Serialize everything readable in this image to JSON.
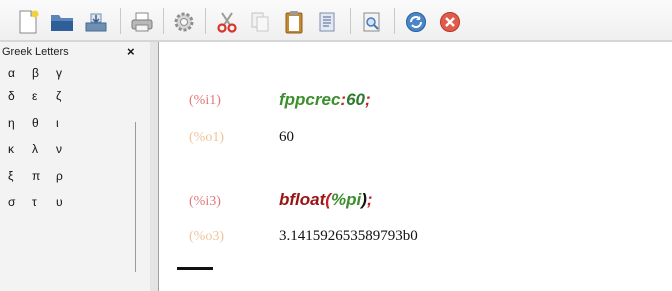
{
  "toolbar": {
    "icons": [
      "new-document-icon",
      "open-folder-icon",
      "save-icon",
      "print-icon",
      "settings-icon",
      "cut-icon",
      "copy-icon",
      "paste-icon",
      "select-all-icon",
      "find-icon",
      "refresh-icon",
      "interrupt-icon"
    ]
  },
  "greek_panel": {
    "title": "Greek Letters",
    "close": "×",
    "rows": [
      [
        "α",
        "β",
        "γ"
      ],
      [
        "δ",
        "ε",
        "ζ"
      ],
      [
        "η",
        "θ",
        "ι"
      ],
      [
        "κ",
        "λ",
        "ν"
      ],
      [
        "ξ",
        "π",
        "ρ"
      ],
      [
        "σ",
        "τ",
        "υ"
      ]
    ]
  },
  "worksheet": {
    "cells": [
      {
        "in_label": "(%i1)",
        "in_parts": [
          [
            "fppcrec",
            "#3d8f2d"
          ],
          [
            ":",
            "#c0212a"
          ],
          [
            "60",
            "#2d7a2d"
          ],
          [
            ";",
            "#c0212a"
          ]
        ],
        "out_label": "(%o1)",
        "output": "60"
      },
      {
        "in_label": "(%i3)",
        "in_parts": [
          [
            "bfloat",
            "#9b1212"
          ],
          [
            "(",
            "#c0212a"
          ],
          [
            "%pi",
            "#3d8f2d"
          ],
          [
            ")",
            "#111111"
          ],
          [
            ";",
            "#c0212a"
          ]
        ],
        "out_label": "(%o3)",
        "output": "3.141592653589793b0"
      }
    ]
  }
}
